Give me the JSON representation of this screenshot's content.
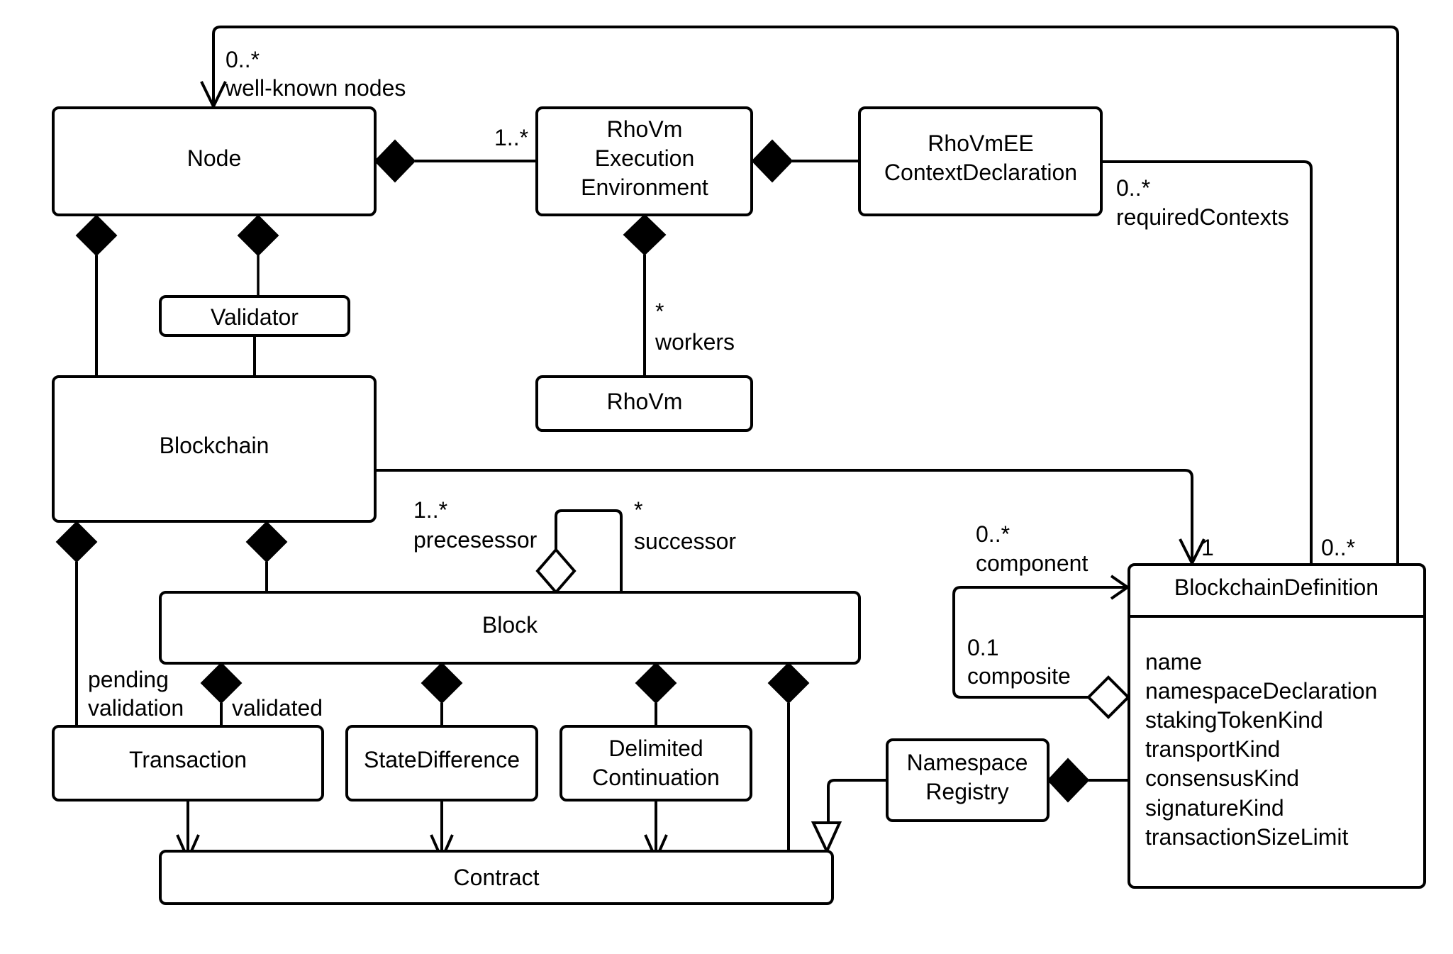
{
  "classes": {
    "node": "Node",
    "rhovm_ee": [
      "RhoVm",
      "Execution",
      "Environment"
    ],
    "rhovm_ee_context": [
      "RhoVmEE",
      "ContextDeclaration"
    ],
    "validator": "Validator",
    "blockchain": "Blockchain",
    "rhovm": "RhoVm",
    "block": "Block",
    "transaction": "Transaction",
    "state_difference": "StateDifference",
    "delimited_continuation": [
      "Delimited",
      "Continuation"
    ],
    "contract": "Contract",
    "namespace_registry": [
      "Namespace",
      "Registry"
    ],
    "blockchain_definition": {
      "name": "BlockchainDefinition",
      "attributes": [
        "name",
        "namespaceDeclaration",
        "stakingTokenKind",
        "transportKind",
        "consensusKind",
        "signatureKind",
        "transactionSizeLimit"
      ]
    }
  },
  "labels": {
    "wellknown_mult": "0..*",
    "wellknown_role": "well-known nodes",
    "node_ee_mult": "1..*",
    "required_mult": "0..*",
    "required_role": "requiredContexts",
    "workers_mult": "*",
    "workers_role": "workers",
    "pred_mult": "1..*",
    "pred_role": "precesessor",
    "succ_mult": "*",
    "succ_role": "successor",
    "component_mult": "0..*",
    "component_role": "component",
    "composite_mult": "0.1",
    "composite_role": "composite",
    "bcdef_one": "1",
    "bcdef_many": "0..*",
    "pending_1": "pending",
    "pending_2": "validation",
    "validated": "validated"
  }
}
